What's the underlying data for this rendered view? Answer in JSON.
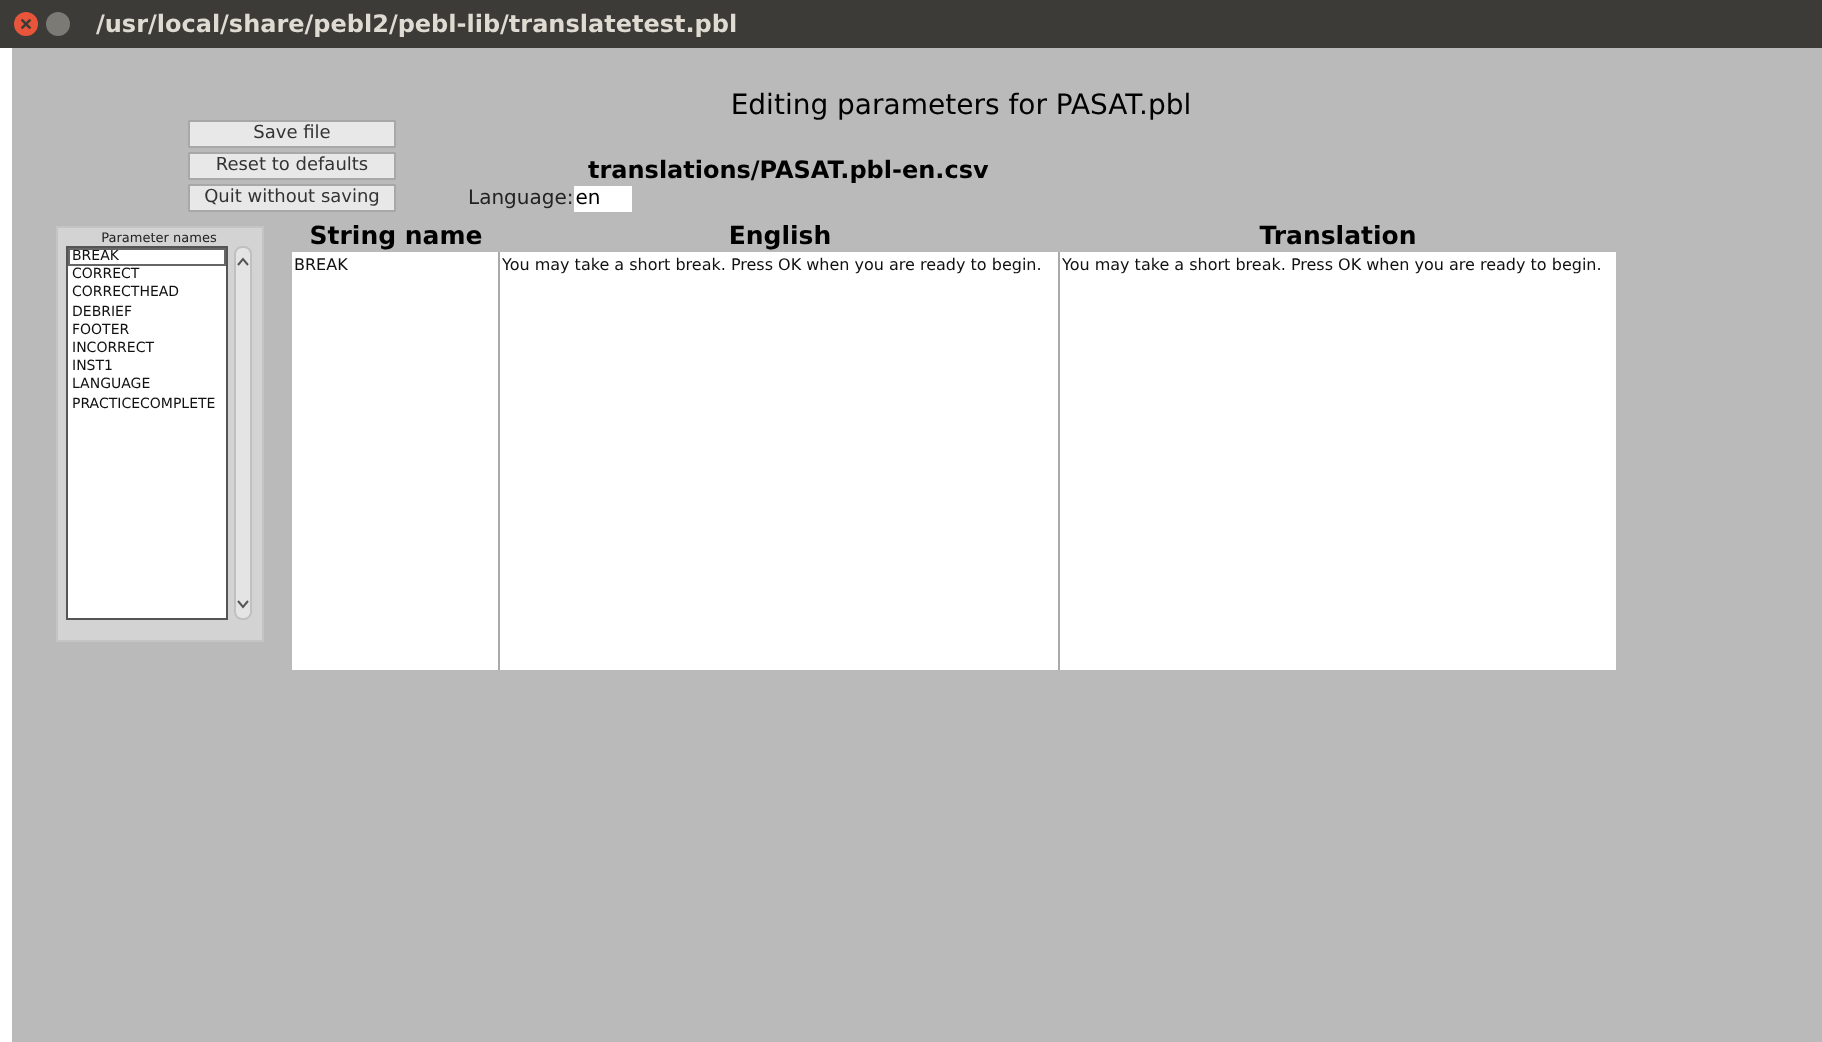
{
  "window": {
    "title": "/usr/local/share/pebl2/pebl-lib/translatetest.pbl"
  },
  "heading": "Editing parameters for PASAT.pbl",
  "buttons": [
    "Save file",
    "Reset to defaults",
    "Quit without saving"
  ],
  "file_path": "translations/PASAT.pbl-en.csv",
  "language": {
    "label": "Language:",
    "value": "en"
  },
  "parameter_list": {
    "title": "Parameter names",
    "items": [
      {
        "label": "BREAK",
        "selected": true
      },
      {
        "label": "CORRECT",
        "selected": false
      },
      {
        "label": "CORRECTHEAD",
        "selected": false
      },
      {
        "label": "DEBRIEF",
        "selected": false
      },
      {
        "label": "FOOTER",
        "selected": false
      },
      {
        "label": "INCORRECT",
        "selected": false
      },
      {
        "label": "INST1",
        "selected": false
      },
      {
        "label": "LANGUAGE",
        "selected": false
      },
      {
        "label": "PRACTICECOMPLETE",
        "selected": false
      }
    ]
  },
  "table": {
    "columns": [
      "String name",
      "English",
      "Translation"
    ],
    "row": [
      "BREAK",
      "You may take a short break. Press OK when you are ready to begin.",
      "You may take a short break. Press OK when you are ready to begin."
    ]
  }
}
